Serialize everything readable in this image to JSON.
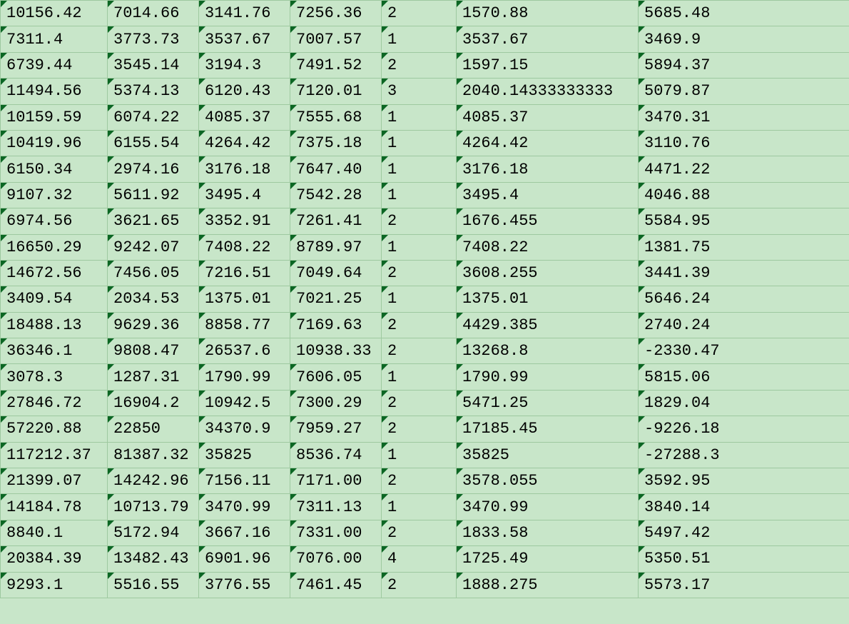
{
  "spreadsheet": {
    "rows": [
      {
        "cells": [
          {
            "v": "10156.42",
            "m": true
          },
          {
            "v": "7014.66",
            "m": true
          },
          {
            "v": "3141.76",
            "m": true
          },
          {
            "v": "7256.36",
            "m": true
          },
          {
            "v": "2",
            "m": true
          },
          {
            "v": "1570.88",
            "m": true
          },
          {
            "v": "5685.48",
            "m": true
          }
        ]
      },
      {
        "cells": [
          {
            "v": "7311.4",
            "m": true
          },
          {
            "v": "3773.73",
            "m": true
          },
          {
            "v": "3537.67",
            "m": true
          },
          {
            "v": "7007.57",
            "m": true
          },
          {
            "v": "1",
            "m": true
          },
          {
            "v": "3537.67",
            "m": true
          },
          {
            "v": "3469.9",
            "m": true
          }
        ]
      },
      {
        "cells": [
          {
            "v": "6739.44",
            "m": true
          },
          {
            "v": "3545.14",
            "m": true
          },
          {
            "v": "3194.3",
            "m": true
          },
          {
            "v": "7491.52",
            "m": true
          },
          {
            "v": "2",
            "m": true
          },
          {
            "v": "1597.15",
            "m": true
          },
          {
            "v": "5894.37",
            "m": true
          }
        ]
      },
      {
        "cells": [
          {
            "v": "11494.56",
            "m": true
          },
          {
            "v": "5374.13",
            "m": true
          },
          {
            "v": "6120.43",
            "m": true
          },
          {
            "v": "7120.01",
            "m": true
          },
          {
            "v": "3",
            "m": true
          },
          {
            "v": "2040.14333333333",
            "m": true
          },
          {
            "v": "5079.87",
            "m": true
          }
        ]
      },
      {
        "cells": [
          {
            "v": "10159.59",
            "m": true
          },
          {
            "v": "6074.22",
            "m": true
          },
          {
            "v": "4085.37",
            "m": true
          },
          {
            "v": "7555.68",
            "m": true
          },
          {
            "v": "1",
            "m": true
          },
          {
            "v": "4085.37",
            "m": true
          },
          {
            "v": "3470.31",
            "m": true
          }
        ]
      },
      {
        "cells": [
          {
            "v": "10419.96",
            "m": true
          },
          {
            "v": "6155.54",
            "m": true
          },
          {
            "v": "4264.42",
            "m": true
          },
          {
            "v": "7375.18",
            "m": true
          },
          {
            "v": "1",
            "m": true
          },
          {
            "v": "4264.42",
            "m": true
          },
          {
            "v": "3110.76",
            "m": true
          }
        ]
      },
      {
        "cells": [
          {
            "v": "6150.34",
            "m": true
          },
          {
            "v": "2974.16",
            "m": true
          },
          {
            "v": "3176.18",
            "m": true
          },
          {
            "v": "7647.40",
            "m": true
          },
          {
            "v": "1",
            "m": true
          },
          {
            "v": "3176.18",
            "m": true
          },
          {
            "v": "4471.22",
            "m": true
          }
        ]
      },
      {
        "cells": [
          {
            "v": "9107.32",
            "m": true
          },
          {
            "v": "5611.92",
            "m": true
          },
          {
            "v": "3495.4",
            "m": true
          },
          {
            "v": "7542.28",
            "m": true
          },
          {
            "v": "1",
            "m": true
          },
          {
            "v": "3495.4",
            "m": true
          },
          {
            "v": "4046.88",
            "m": true
          }
        ]
      },
      {
        "cells": [
          {
            "v": "6974.56",
            "m": true
          },
          {
            "v": "3621.65",
            "m": true
          },
          {
            "v": "3352.91",
            "m": true
          },
          {
            "v": "7261.41",
            "m": true
          },
          {
            "v": "2",
            "m": true
          },
          {
            "v": "1676.455",
            "m": true
          },
          {
            "v": "5584.95",
            "m": true
          }
        ]
      },
      {
        "cells": [
          {
            "v": "16650.29",
            "m": true
          },
          {
            "v": "9242.07",
            "m": true
          },
          {
            "v": "7408.22",
            "m": true
          },
          {
            "v": "8789.97",
            "m": true
          },
          {
            "v": "1",
            "m": true
          },
          {
            "v": "7408.22",
            "m": true
          },
          {
            "v": "1381.75",
            "m": true
          }
        ]
      },
      {
        "cells": [
          {
            "v": "14672.56",
            "m": true
          },
          {
            "v": "7456.05",
            "m": true
          },
          {
            "v": "7216.51",
            "m": true
          },
          {
            "v": "7049.64",
            "m": true
          },
          {
            "v": "2",
            "m": true
          },
          {
            "v": "3608.255",
            "m": true
          },
          {
            "v": "3441.39",
            "m": true
          }
        ]
      },
      {
        "cells": [
          {
            "v": "3409.54",
            "m": true
          },
          {
            "v": "2034.53",
            "m": true
          },
          {
            "v": "1375.01",
            "m": true
          },
          {
            "v": "7021.25",
            "m": true
          },
          {
            "v": "1",
            "m": true
          },
          {
            "v": "1375.01",
            "m": true
          },
          {
            "v": "5646.24",
            "m": true
          }
        ]
      },
      {
        "cells": [
          {
            "v": "18488.13",
            "m": true
          },
          {
            "v": "9629.36",
            "m": true
          },
          {
            "v": "8858.77",
            "m": true
          },
          {
            "v": "7169.63",
            "m": true
          },
          {
            "v": "2",
            "m": true
          },
          {
            "v": "4429.385",
            "m": true
          },
          {
            "v": "2740.24",
            "m": true
          }
        ]
      },
      {
        "cells": [
          {
            "v": "36346.1",
            "m": true
          },
          {
            "v": "9808.47",
            "m": true
          },
          {
            "v": "26537.6",
            "m": true
          },
          {
            "v": "10938.33",
            "m": false
          },
          {
            "v": "2",
            "m": false
          },
          {
            "v": "13268.8",
            "m": true
          },
          {
            "v": "-2330.47",
            "m": true
          }
        ]
      },
      {
        "cells": [
          {
            "v": "3078.3",
            "m": true
          },
          {
            "v": "1287.31",
            "m": true
          },
          {
            "v": "1790.99",
            "m": true
          },
          {
            "v": "7606.05",
            "m": true
          },
          {
            "v": "1",
            "m": true
          },
          {
            "v": "1790.99",
            "m": true
          },
          {
            "v": "5815.06",
            "m": true
          }
        ]
      },
      {
        "cells": [
          {
            "v": "27846.72",
            "m": true
          },
          {
            "v": "16904.2",
            "m": true
          },
          {
            "v": "10942.5",
            "m": true
          },
          {
            "v": "7300.29",
            "m": true
          },
          {
            "v": "2",
            "m": true
          },
          {
            "v": "5471.25",
            "m": true
          },
          {
            "v": "1829.04",
            "m": true
          }
        ]
      },
      {
        "cells": [
          {
            "v": "57220.88",
            "m": true
          },
          {
            "v": "22850",
            "m": true
          },
          {
            "v": "34370.9",
            "m": true
          },
          {
            "v": "7959.27",
            "m": true
          },
          {
            "v": "2",
            "m": true
          },
          {
            "v": "17185.45",
            "m": true
          },
          {
            "v": "-9226.18",
            "m": true
          }
        ]
      },
      {
        "cells": [
          {
            "v": "117212.37",
            "m": true
          },
          {
            "v": "81387.32",
            "m": false
          },
          {
            "v": "35825",
            "m": true
          },
          {
            "v": "8536.74",
            "m": true
          },
          {
            "v": "1",
            "m": true
          },
          {
            "v": "35825",
            "m": true
          },
          {
            "v": "-27288.3",
            "m": true
          }
        ]
      },
      {
        "cells": [
          {
            "v": "21399.07",
            "m": true
          },
          {
            "v": "14242.96",
            "m": true
          },
          {
            "v": "7156.11",
            "m": true
          },
          {
            "v": "7171.00",
            "m": true
          },
          {
            "v": "2",
            "m": true
          },
          {
            "v": "3578.055",
            "m": true
          },
          {
            "v": "3592.95",
            "m": true
          }
        ]
      },
      {
        "cells": [
          {
            "v": "14184.78",
            "m": true
          },
          {
            "v": "10713.79",
            "m": true
          },
          {
            "v": "3470.99",
            "m": true
          },
          {
            "v": "7311.13",
            "m": true
          },
          {
            "v": "1",
            "m": true
          },
          {
            "v": "3470.99",
            "m": true
          },
          {
            "v": "3840.14",
            "m": true
          }
        ]
      },
      {
        "cells": [
          {
            "v": "8840.1",
            "m": true
          },
          {
            "v": "5172.94",
            "m": true
          },
          {
            "v": "3667.16",
            "m": true
          },
          {
            "v": "7331.00",
            "m": true
          },
          {
            "v": "2",
            "m": true
          },
          {
            "v": "1833.58",
            "m": true
          },
          {
            "v": "5497.42",
            "m": true
          }
        ]
      },
      {
        "cells": [
          {
            "v": "20384.39",
            "m": true
          },
          {
            "v": "13482.43",
            "m": true
          },
          {
            "v": "6901.96",
            "m": true
          },
          {
            "v": "7076.00",
            "m": true
          },
          {
            "v": "4",
            "m": true
          },
          {
            "v": "1725.49",
            "m": true
          },
          {
            "v": "5350.51",
            "m": true
          }
        ]
      },
      {
        "cells": [
          {
            "v": "9293.1",
            "m": true
          },
          {
            "v": "5516.55",
            "m": true
          },
          {
            "v": "3776.55",
            "m": true
          },
          {
            "v": "7461.45",
            "m": true
          },
          {
            "v": "2",
            "m": true
          },
          {
            "v": "1888.275",
            "m": true
          },
          {
            "v": "5573.17",
            "m": true
          }
        ]
      }
    ]
  }
}
